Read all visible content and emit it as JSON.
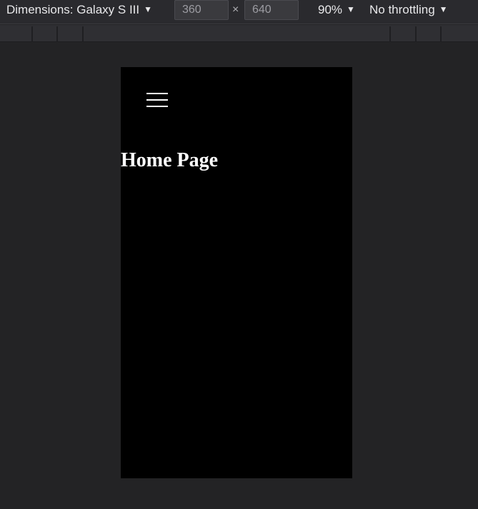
{
  "toolbar": {
    "dimensions_label": "Dimensions: Galaxy S III",
    "width_value": "360",
    "times_symbol": "×",
    "height_value": "640",
    "zoom_label": "90%",
    "throttling_label": "No throttling",
    "caret_symbol": "▼"
  },
  "page": {
    "heading": "Home Page"
  },
  "colors": {
    "chrome_background": "#232325",
    "toolbar_background": "#2a2a2e",
    "viewport_background": "#000000",
    "text_light": "#e8e8ea",
    "page_text": "#ffffff"
  },
  "icons": {
    "menu": "hamburger-menu-icon",
    "dropdown": "caret-down-icon"
  }
}
